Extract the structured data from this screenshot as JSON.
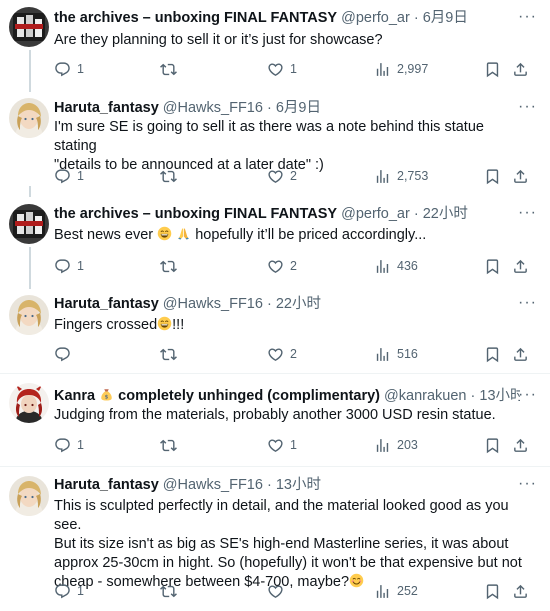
{
  "tweets": [
    {
      "name": "the archives – unboxing FINAL FANTASY",
      "handle": "@perfo_ar",
      "sep": "·",
      "time": "6月9日",
      "text": "Are they planning to sell it or it’s just for showcase?",
      "replies": "1",
      "retweets": "",
      "likes": "1",
      "views": "2,997"
    },
    {
      "name": "Haruta_fantasy",
      "handle": "@Hawks_FF16",
      "sep": "·",
      "time": "6月9日",
      "text_line1": "I'm sure SE is going to sell it as there was a note behind this statue stating",
      "text_line2": "\"details to be announced at a later date\" :)",
      "replies": "1",
      "retweets": "",
      "likes": "2",
      "views": "2,753"
    },
    {
      "name": "the archives – unboxing FINAL FANTASY",
      "handle": "@perfo_ar",
      "sep": "·",
      "time": "22小时",
      "text_a": "Best news ever",
      "text_b": "hopefully it’ll be priced accordingly...",
      "replies": "1",
      "retweets": "",
      "likes": "2",
      "views": "436"
    },
    {
      "name": "Haruta_fantasy",
      "handle": "@Hawks_FF16",
      "sep": "·",
      "time": "22小时",
      "text_a": "Fingers crossed",
      "text_b": "!!!",
      "replies": "",
      "retweets": "",
      "likes": "2",
      "views": "516"
    },
    {
      "name_a": "Kanra",
      "name_b": "completely unhinged (complimentary)",
      "handle": "@kanrakuen",
      "sep": "·",
      "time": "13小时",
      "text": "Judging from the materials, probably another 3000 USD resin statue.",
      "replies": "1",
      "retweets": "",
      "likes": "1",
      "views": "203"
    },
    {
      "name": "Haruta_fantasy",
      "handle": "@Hawks_FF16",
      "sep": "·",
      "time": "13小时",
      "lines": [
        "This is sculpted perfectly in detail, and the material looked good as you see.",
        "But its size isn't as big as SE's high-end Masterline series, it was about",
        "approx 25-30cm in hight. So (hopefully) it won't be that expensive but not"
      ],
      "last_line": "cheap - somewhere between $4-700, maybe?",
      "replies": "1",
      "retweets": "",
      "likes": "",
      "views": "252"
    }
  ],
  "colors": {
    "text": "#0f1419",
    "secondary": "#536471",
    "divider": "#eff3f4",
    "thread": "#cfd9de"
  },
  "icons": [
    "reply-icon",
    "retweet-icon",
    "like-icon",
    "views-icon",
    "bookmark-icon",
    "share-icon",
    "more-icon"
  ]
}
